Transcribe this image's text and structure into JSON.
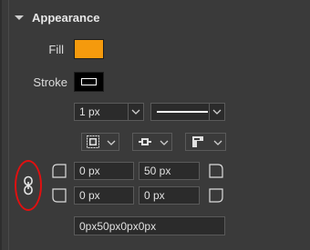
{
  "section": {
    "title": "Appearance"
  },
  "fill": {
    "label": "Fill",
    "color": "#f59a0d"
  },
  "stroke": {
    "label": "Stroke",
    "color": "#000000"
  },
  "stroke_width": {
    "value": "1 px"
  },
  "stroke_style": {
    "value": "solid line"
  },
  "align_buttons": [
    "stroke-align-inside-icon",
    "stroke-cap-icon",
    "stroke-join-icon"
  ],
  "radius": {
    "top_left": "0 px",
    "top_right": "50 px",
    "bottom_left": "0 px",
    "bottom_right": "0 px",
    "css_value": "0px50px0px0px"
  },
  "link_icon": "chain-link-icon",
  "highlight_color": "#e01010"
}
